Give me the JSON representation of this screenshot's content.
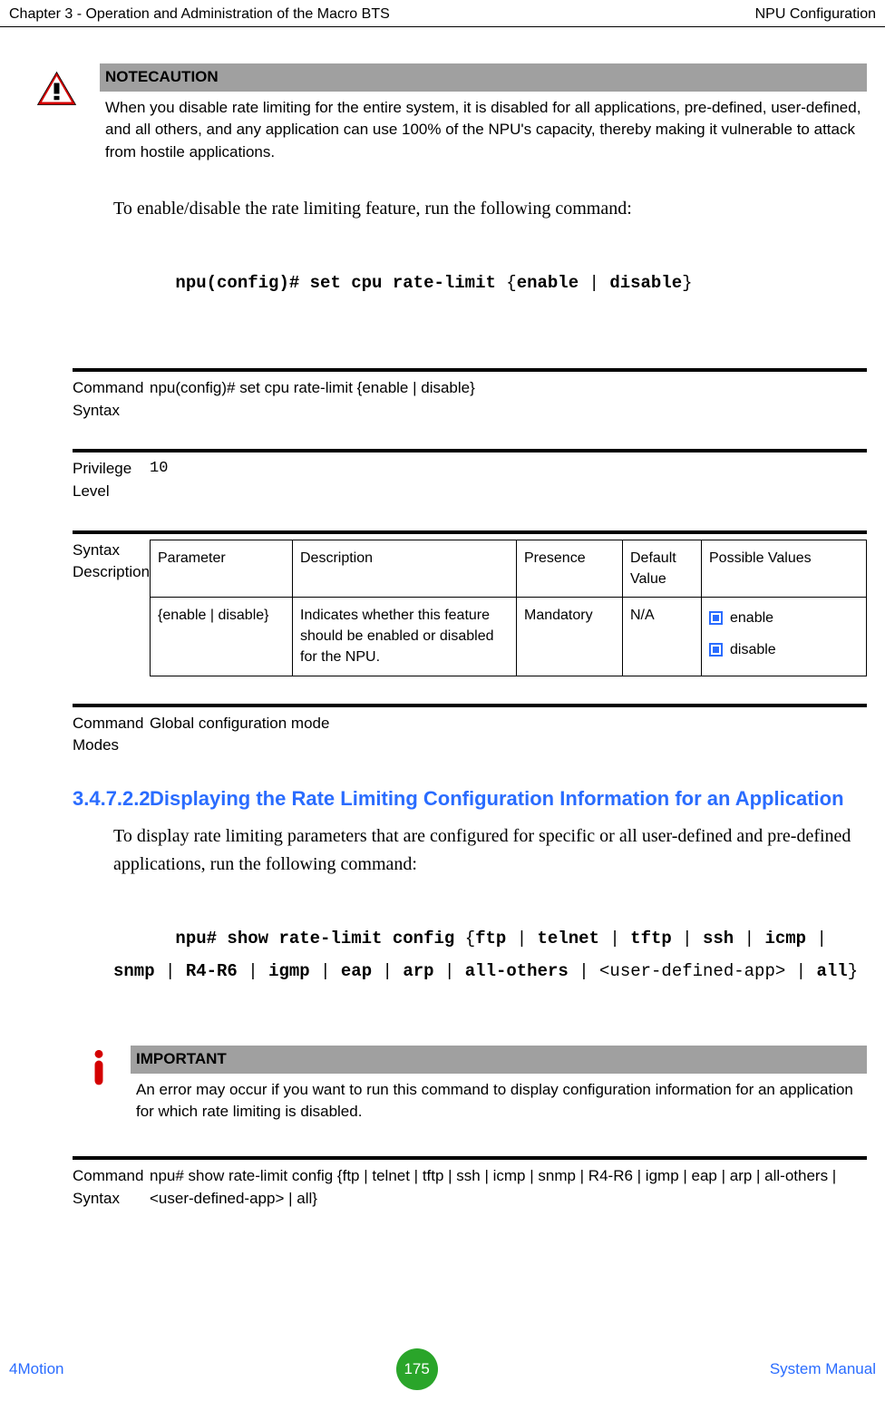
{
  "header": {
    "left": "Chapter 3 - Operation and Administration of the Macro BTS",
    "right": "NPU Configuration"
  },
  "notecaution": {
    "title": "NOTECAUTION",
    "body": "When you disable rate limiting for the entire system, it is disabled for all applications, pre-defined, user-defined, and all others, and any application can use 100% of the NPU's capacity, thereby making it vulnerable to attack from hostile applications."
  },
  "intro": {
    "line": "To enable/disable the rate limiting feature, run the following command:",
    "cmd_prefix": "npu(config)# set cpu rate-limit ",
    "cmd_brace_open": "{",
    "cmd_opt1": "enable",
    "cmd_pipe": " | ",
    "cmd_opt2": "disable",
    "cmd_brace_close": "}"
  },
  "spec": {
    "cmd_syntax_label": "Command Syntax",
    "cmd_syntax_value": "npu(config)# set cpu rate-limit {enable | disable}",
    "priv_label": "Privilege Level",
    "priv_value": "10",
    "syntax_desc_label": "Syntax Description",
    "cmd_modes_label": "Command Modes",
    "cmd_modes_value": "Global configuration mode"
  },
  "syntax_table": {
    "headers": {
      "param": "Parameter",
      "desc": "Description",
      "pres": "Presence",
      "def": "Default Value",
      "poss": "Possible Values"
    },
    "row": {
      "param": "{enable | disable}",
      "desc": "Indicates whether this feature should be enabled or disabled for the NPU.",
      "pres": "Mandatory",
      "def": "N/A",
      "poss1": "enable",
      "poss2": "disable"
    }
  },
  "section": {
    "num": "3.4.7.2.2",
    "title": "Displaying the Rate Limiting Configuration Information for an Application",
    "body": "To display rate limiting parameters that are configured for specific or all user-defined and pre-defined applications, run the following command:",
    "cmd_prefix": "npu# show rate-limit config ",
    "cmd_brace_open": "{",
    "opts": [
      "ftp",
      "telnet",
      "tftp",
      "ssh",
      "icmp",
      "snmp",
      "R4-R6",
      "igmp",
      "eap",
      "arp",
      "all-others"
    ],
    "user_app": "<user-defined-app>",
    "all": "all",
    "pipe": " | ",
    "brace_close": "}"
  },
  "important": {
    "title": "IMPORTANT",
    "body": "An error may occur if you want to run this command to display configuration information for an application for which rate limiting is disabled."
  },
  "spec2": {
    "cmd_syntax_label": "Command Syntax",
    "cmd_syntax_value": "npu# show rate-limit config {ftp | telnet | tftp | ssh | icmp | snmp | R4-R6 | igmp | eap | arp | all-others | <user-defined-app> | all}"
  },
  "footer": {
    "left": "4Motion",
    "page": "175",
    "right": "System Manual"
  }
}
